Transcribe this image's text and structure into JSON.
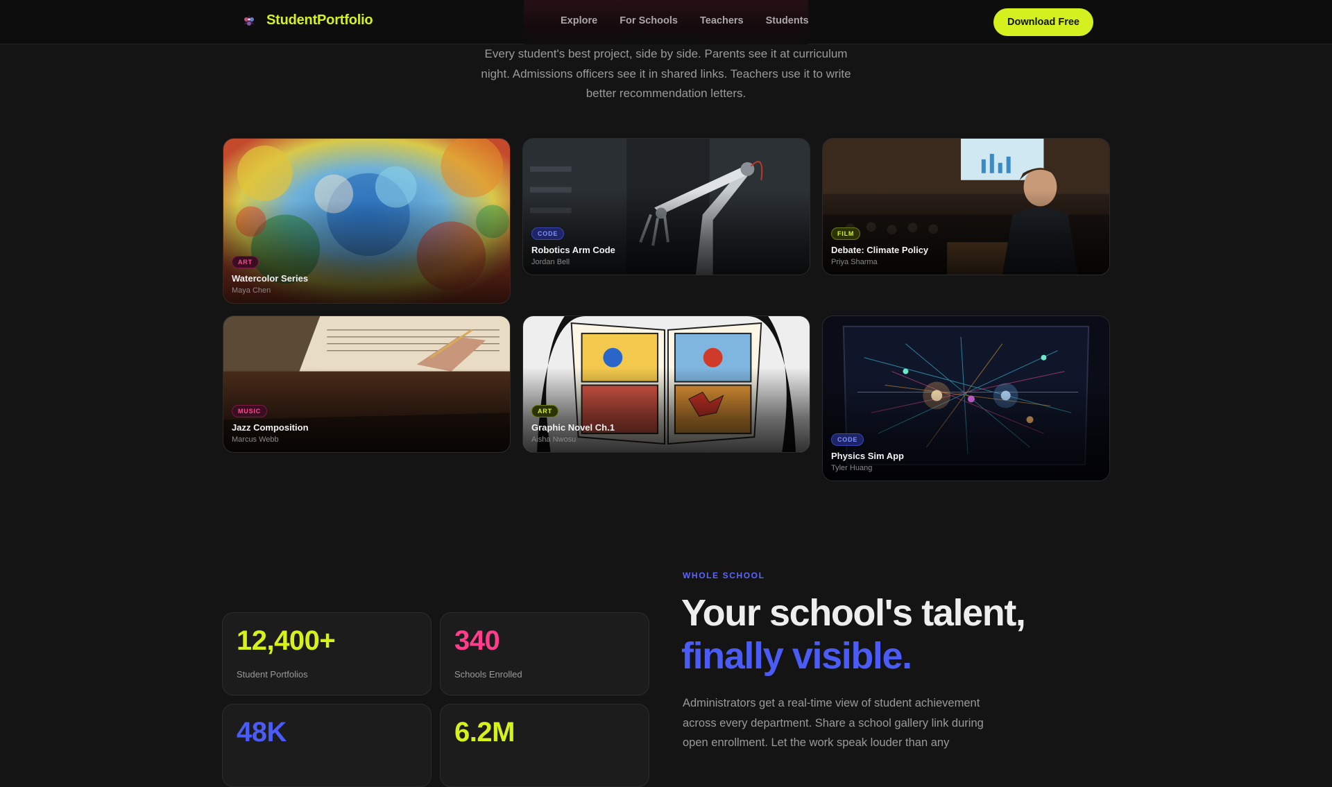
{
  "nav": {
    "brand": "StudentPortfolio",
    "links": [
      "Explore",
      "For Schools",
      "Teachers",
      "Students"
    ],
    "cta": "Download Free"
  },
  "hero": {
    "subtext": "Every student's best project, side by side. Parents see it at curriculum night. Admissions officers see it in shared links. Teachers use it to write better recommendation letters."
  },
  "gallery": [
    {
      "tag": "ART",
      "title": "Watercolor Series",
      "author": "Maya Chen"
    },
    {
      "tag": "CODE",
      "title": "Robotics Arm Code",
      "author": "Jordan Bell"
    },
    {
      "tag": "FILM",
      "title": "Debate: Climate Policy",
      "author": "Priya Sharma"
    },
    {
      "tag": "MUSIC",
      "title": "Jazz Composition",
      "author": "Marcus Webb"
    },
    {
      "tag": "ART",
      "title": "Graphic Novel Ch.1",
      "author": "Aisha Nwosu"
    },
    {
      "tag": "CODE",
      "title": "Physics Sim App",
      "author": "Tyler Huang"
    }
  ],
  "stats": [
    {
      "value": "12,400+",
      "label": "Student Portfolios",
      "color": "#d7f21a"
    },
    {
      "value": "340",
      "label": "Schools Enrolled",
      "color": "#ff3d8b"
    },
    {
      "value": "48K",
      "label": "",
      "color": "#4b5bf6"
    },
    {
      "value": "6.2M",
      "label": "",
      "color": "#d7f21a"
    }
  ],
  "section": {
    "eyebrow": "WHOLE SCHOOL",
    "headline_main": "Your school's talent,",
    "headline_accent": "finally visible.",
    "body": "Administrators get a real-time view of student achievement across every department. Share a school gallery link during open enrollment. Let the work speak louder than any"
  },
  "icons": {
    "brand_logo": "palette-icon"
  }
}
